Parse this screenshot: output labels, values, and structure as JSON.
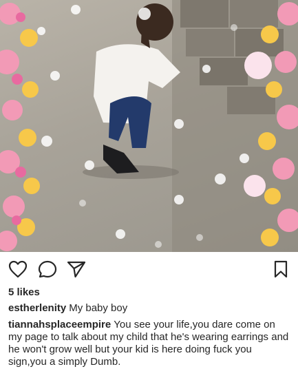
{
  "post": {
    "likes_text": "5 likes",
    "photo_description": "child-photo",
    "caption": {
      "username": "estherlenity",
      "text": "My baby boy"
    },
    "comments": [
      {
        "username": "tiannahsplaceempire",
        "text": "You see your life,you dare come on my page to talk about my child that he's wearing earrings and he won't grow well but your kid is here doing fuck you sign,you a simply Dumb."
      }
    ]
  },
  "icons": {
    "like": "heart-icon",
    "comment": "comment-bubble-icon",
    "share": "paper-plane-icon",
    "save": "bookmark-icon"
  }
}
